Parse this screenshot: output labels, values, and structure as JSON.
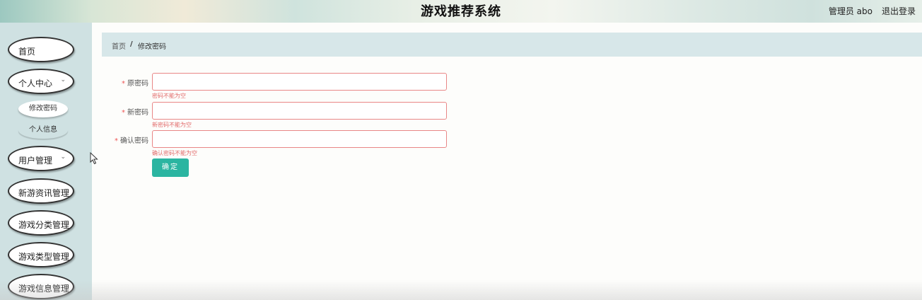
{
  "header": {
    "title": "游戏推荐系统",
    "user": "管理员 abo",
    "logout": "退出登录"
  },
  "sidebar": {
    "items": [
      {
        "label": "首页"
      },
      {
        "label": "个人中心",
        "expanded": true,
        "icon": "chevron-down-icon"
      },
      {
        "label": "修改密码",
        "active": true
      },
      {
        "label": "个人信息"
      },
      {
        "label": "用户管理",
        "icon": "chevron-down-icon"
      },
      {
        "label": "新游资讯管理"
      },
      {
        "label": "游戏分类管理"
      },
      {
        "label": "游戏类型管理"
      },
      {
        "label": "游戏信息管理"
      }
    ],
    "chevron": "⌄"
  },
  "breadcrumb": {
    "home": "首页",
    "separator": "/",
    "current": "修改密码"
  },
  "form": {
    "required_mark": "*",
    "fields": [
      {
        "label": "原密码",
        "value": "",
        "error": "密码不能为空"
      },
      {
        "label": "新密码",
        "value": "",
        "error": "新密码不能为空"
      },
      {
        "label": "确认密码",
        "value": "",
        "error": "确认密码不能为空"
      }
    ],
    "submit": "确定"
  },
  "colors": {
    "accent": "#2bb5a1",
    "error": "#e26b6b",
    "sidebar_bg": "#cfe1e2",
    "breadcrumb_bg": "#d7e7e9"
  }
}
